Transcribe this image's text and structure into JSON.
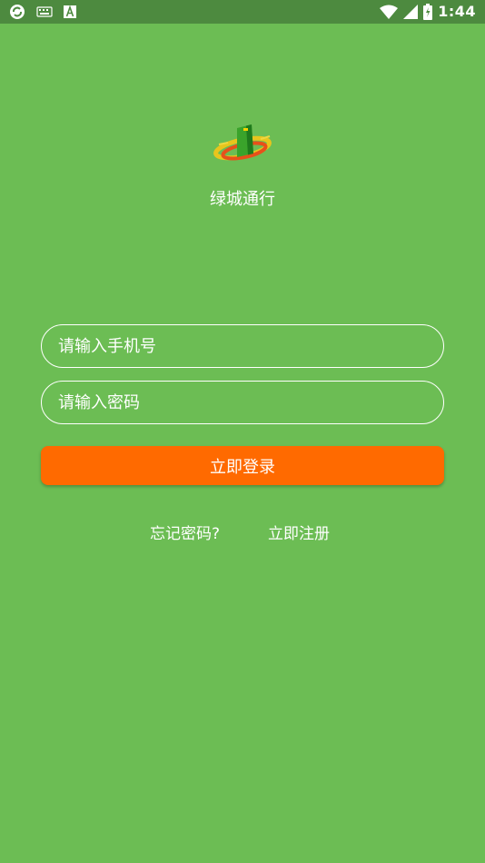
{
  "status_bar": {
    "time": "1:44",
    "left_icons": [
      "sync-icon",
      "keyboard-icon",
      "text-a-icon"
    ],
    "right_icons": [
      "wifi-icon",
      "signal-icon",
      "battery-icon"
    ],
    "color": "#4d8a3f"
  },
  "app": {
    "name": "绿城通行",
    "logo_icon": "app-logo-icon",
    "background": "#6cbd54"
  },
  "login": {
    "phone_placeholder": "请输入手机号",
    "phone_value": "",
    "password_placeholder": "请输入密码",
    "password_value": "",
    "login_label": "立即登录",
    "login_color": "#ff6a00",
    "forgot_label": "忘记密码?",
    "register_label": "立即注册"
  }
}
